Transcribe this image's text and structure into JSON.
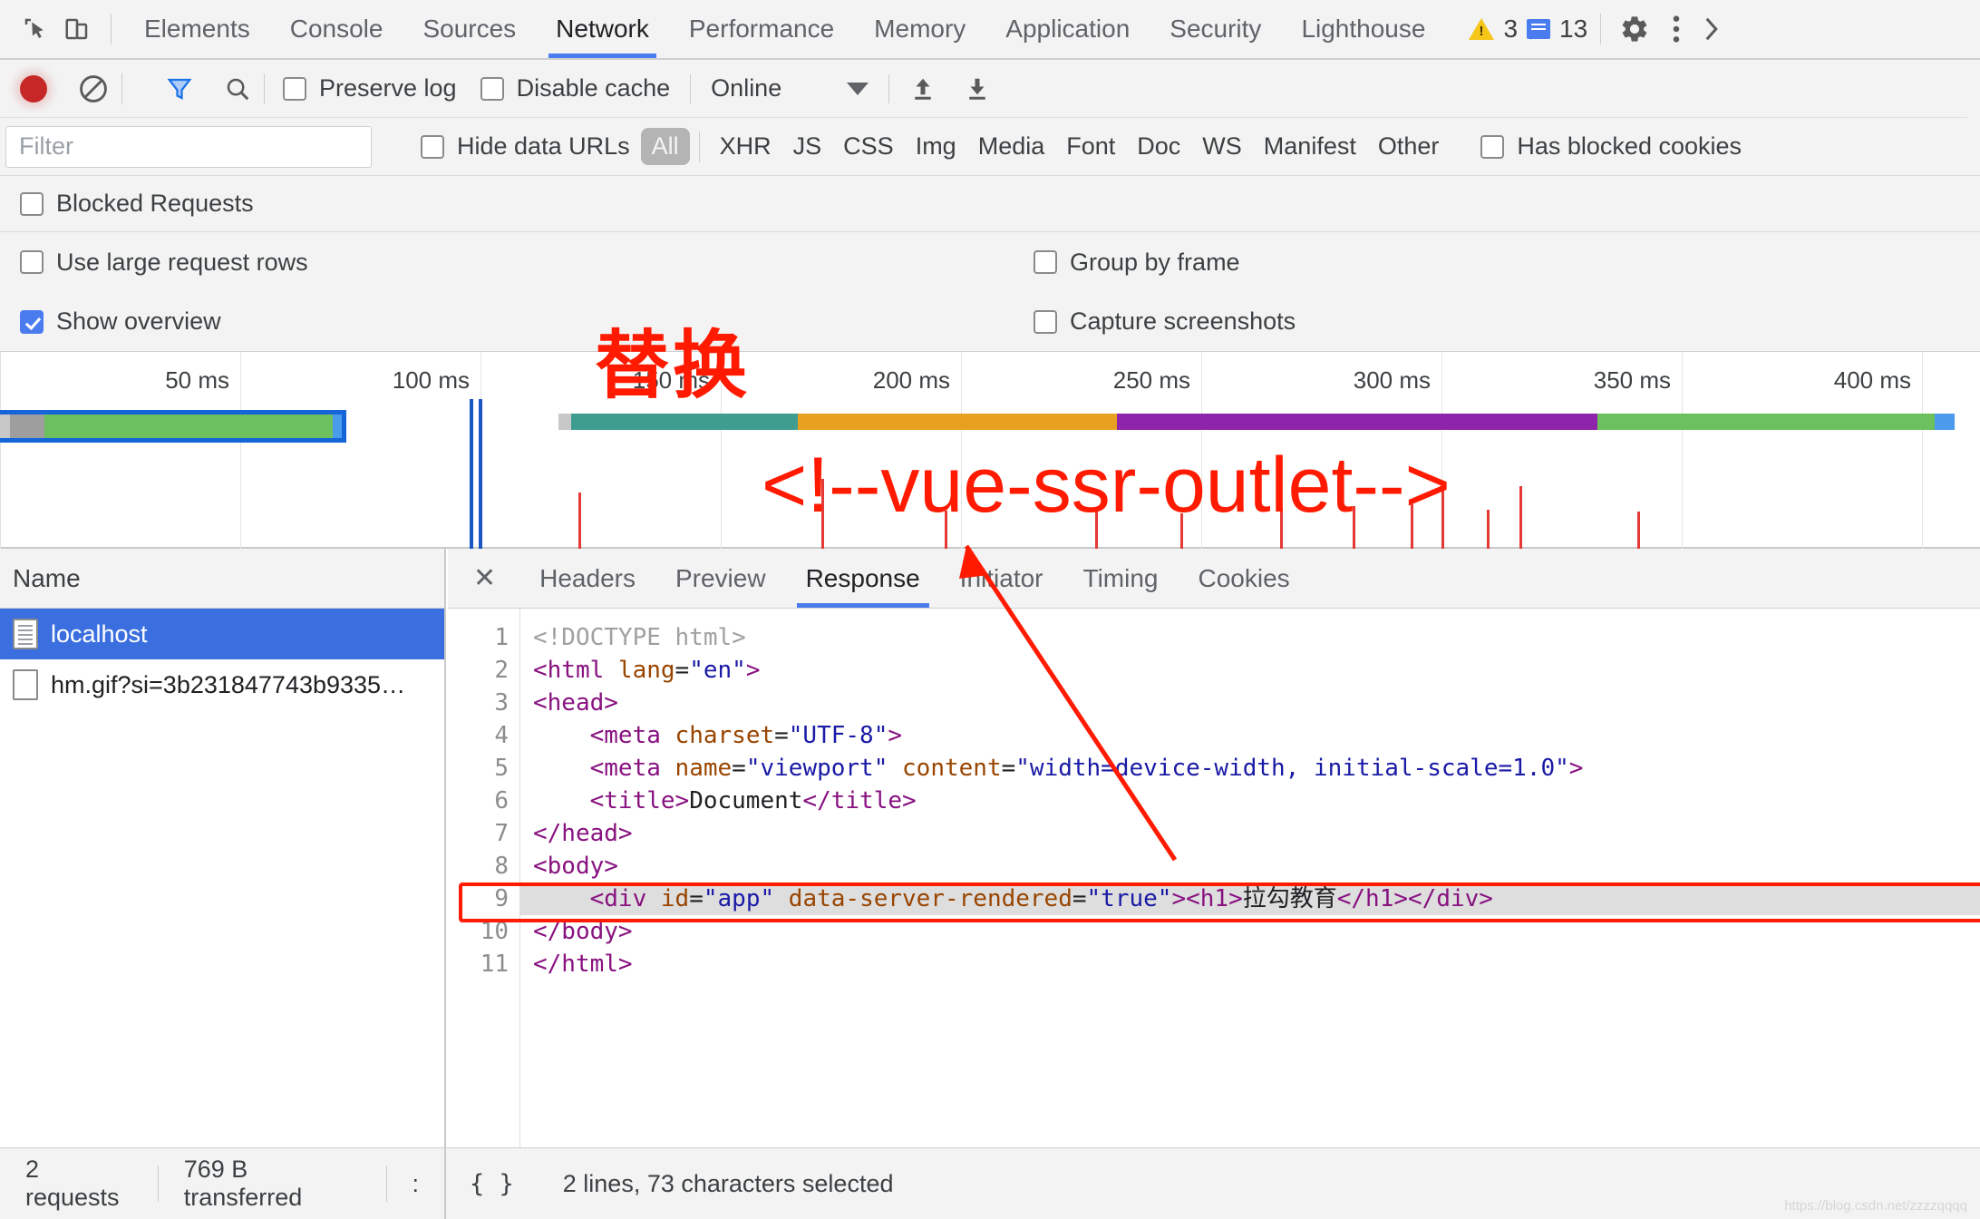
{
  "devtools": {
    "main_tabs": [
      {
        "label": "Elements",
        "active": false
      },
      {
        "label": "Console",
        "active": false
      },
      {
        "label": "Sources",
        "active": false
      },
      {
        "label": "Network",
        "active": true
      },
      {
        "label": "Performance",
        "active": false
      },
      {
        "label": "Memory",
        "active": false
      },
      {
        "label": "Application",
        "active": false
      },
      {
        "label": "Security",
        "active": false
      },
      {
        "label": "Lighthouse",
        "active": false
      }
    ],
    "counters": {
      "warnings": "3",
      "messages": "13"
    },
    "icons": {
      "inspect": "inspect-element-icon",
      "device": "device-toolbar-icon",
      "settings": "gear-icon",
      "more": "more-options-icon"
    }
  },
  "record_toolbar": {
    "record_title": "Record",
    "clear_title": "Clear",
    "filter_title": "Filter",
    "search_title": "Search",
    "preserve_log": {
      "label": "Preserve log",
      "checked": false
    },
    "disable_cache": {
      "label": "Disable cache",
      "checked": false
    },
    "throttling": "Online",
    "import_title": "Import HAR",
    "export_title": "Export HAR"
  },
  "filter_bar": {
    "filter_placeholder": "Filter",
    "filter_value": "",
    "hide_data_urls": {
      "label": "Hide data URLs",
      "checked": false
    },
    "types": [
      {
        "label": "All",
        "selected": true
      },
      {
        "label": "XHR",
        "selected": false
      },
      {
        "label": "JS",
        "selected": false
      },
      {
        "label": "CSS",
        "selected": false
      },
      {
        "label": "Img",
        "selected": false
      },
      {
        "label": "Media",
        "selected": false
      },
      {
        "label": "Font",
        "selected": false
      },
      {
        "label": "Doc",
        "selected": false
      },
      {
        "label": "WS",
        "selected": false
      },
      {
        "label": "Manifest",
        "selected": false
      },
      {
        "label": "Other",
        "selected": false
      }
    ],
    "has_blocked_cookies": {
      "label": "Has blocked cookies",
      "checked": false
    }
  },
  "options": {
    "blocked_requests": {
      "label": "Blocked Requests",
      "checked": false
    },
    "use_large_request_rows": {
      "label": "Use large request rows",
      "checked": false
    },
    "group_by_frame": {
      "label": "Group by frame",
      "checked": false
    },
    "show_overview": {
      "label": "Show overview",
      "checked": true
    },
    "capture_screenshots": {
      "label": "Capture screenshots",
      "checked": false
    }
  },
  "overview": {
    "ticks": [
      "50 ms",
      "100 ms",
      "150 ms",
      "200 ms",
      "250 ms",
      "300 ms",
      "350 ms",
      "400 ms"
    ],
    "colors": {
      "blue_border": "#1565d8",
      "green": "#6dc05e",
      "teal": "#3f9d8f",
      "orange": "#e8a020",
      "purple": "#8e24aa",
      "light_blue": "#4a9bec",
      "grey": "#c8c8c8",
      "red_event": "#e53935"
    }
  },
  "requests": {
    "column_header": "Name",
    "rows": [
      {
        "name": "localhost",
        "icon": "document-icon",
        "selected": true
      },
      {
        "name": "hm.gif?si=3b231847743b9335…",
        "icon": "image-placeholder-icon",
        "selected": false
      }
    ]
  },
  "detail_tabs": [
    {
      "label": "Headers",
      "active": false
    },
    {
      "label": "Preview",
      "active": false
    },
    {
      "label": "Response",
      "active": true
    },
    {
      "label": "Initiator",
      "active": false
    },
    {
      "label": "Timing",
      "active": false
    },
    {
      "label": "Cookies",
      "active": false
    }
  ],
  "close_label": "✕",
  "code": {
    "lines": [
      {
        "n": "1",
        "tokens": [
          {
            "t": "<!DOCTYPE html>",
            "c": "t-grey"
          }
        ],
        "highlight": false
      },
      {
        "n": "2",
        "tokens": [
          {
            "t": "<html ",
            "c": "t-tag"
          },
          {
            "t": "lang",
            "c": "t-attr"
          },
          {
            "t": "=",
            "c": "t-txt"
          },
          {
            "t": "\"en\"",
            "c": "t-val"
          },
          {
            "t": ">",
            "c": "t-tag"
          }
        ],
        "highlight": false
      },
      {
        "n": "3",
        "tokens": [
          {
            "t": "<head>",
            "c": "t-tag"
          }
        ],
        "highlight": false
      },
      {
        "n": "4",
        "tokens": [
          {
            "t": "    <meta ",
            "c": "t-tag"
          },
          {
            "t": "charset",
            "c": "t-attr"
          },
          {
            "t": "=",
            "c": "t-txt"
          },
          {
            "t": "\"UTF-8\"",
            "c": "t-val"
          },
          {
            "t": ">",
            "c": "t-tag"
          }
        ],
        "highlight": false
      },
      {
        "n": "5",
        "tokens": [
          {
            "t": "    <meta ",
            "c": "t-tag"
          },
          {
            "t": "name",
            "c": "t-attr"
          },
          {
            "t": "=",
            "c": "t-txt"
          },
          {
            "t": "\"viewport\"",
            "c": "t-val"
          },
          {
            "t": " ",
            "c": "t-txt"
          },
          {
            "t": "content",
            "c": "t-attr"
          },
          {
            "t": "=",
            "c": "t-txt"
          },
          {
            "t": "\"width=device-width, initial-scale=1.0\"",
            "c": "t-val"
          },
          {
            "t": ">",
            "c": "t-tag"
          }
        ],
        "highlight": false
      },
      {
        "n": "6",
        "tokens": [
          {
            "t": "    <title>",
            "c": "t-tag"
          },
          {
            "t": "Document",
            "c": "t-txt"
          },
          {
            "t": "</title>",
            "c": "t-tag"
          }
        ],
        "highlight": false
      },
      {
        "n": "7",
        "tokens": [
          {
            "t": "</head>",
            "c": "t-tag"
          }
        ],
        "highlight": false
      },
      {
        "n": "8",
        "tokens": [
          {
            "t": "<body>",
            "c": "t-tag"
          }
        ],
        "highlight": false
      },
      {
        "n": "9",
        "tokens": [
          {
            "t": "    <div ",
            "c": "t-tag"
          },
          {
            "t": "id",
            "c": "t-attr"
          },
          {
            "t": "=",
            "c": "t-txt"
          },
          {
            "t": "\"app\"",
            "c": "t-val"
          },
          {
            "t": " ",
            "c": "t-txt"
          },
          {
            "t": "data-server-rendered",
            "c": "t-attr"
          },
          {
            "t": "=",
            "c": "t-txt"
          },
          {
            "t": "\"true\"",
            "c": "t-val"
          },
          {
            "t": "><h1>",
            "c": "t-tag"
          },
          {
            "t": "拉勾教育",
            "c": "t-txt"
          },
          {
            "t": "</h1></div>",
            "c": "t-tag"
          }
        ],
        "highlight": true
      },
      {
        "n": "10",
        "tokens": [
          {
            "t": "</body>",
            "c": "t-tag"
          }
        ],
        "highlight": false
      },
      {
        "n": "11",
        "tokens": [
          {
            "t": "</html>",
            "c": "t-tag"
          }
        ],
        "highlight": false
      }
    ]
  },
  "status_bar": {
    "requests": "2 requests",
    "transferred": "769 B transferred",
    "third": ":",
    "pretty_print": "{ }",
    "selection": "2 lines, 73 characters selected"
  },
  "annotations": {
    "replace_label": "替换",
    "outlet_label": "<!--vue-ssr-outlet-->",
    "color": "#ff1a00"
  },
  "watermark": "https://blog.csdn.net/zzzzqqqq"
}
